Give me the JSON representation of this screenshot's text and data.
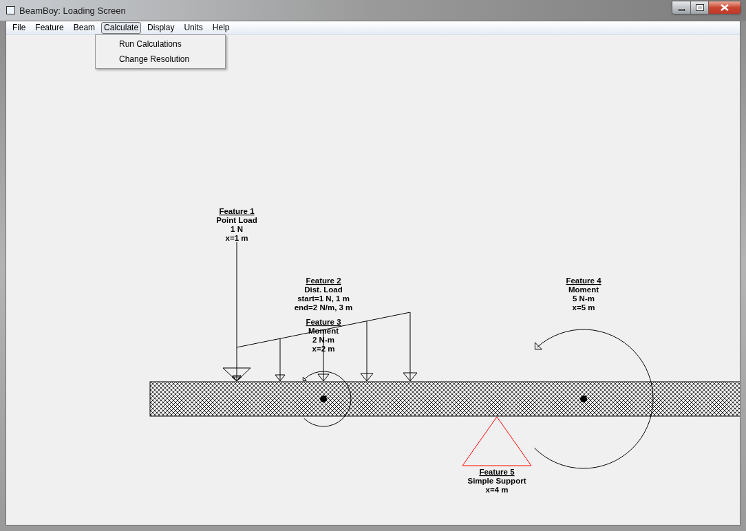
{
  "window": {
    "title": "BeamBoy: Loading Screen"
  },
  "menu": [
    {
      "label": "File",
      "selected": false
    },
    {
      "label": "Feature",
      "selected": false
    },
    {
      "label": "Beam",
      "selected": false
    },
    {
      "label": "Calculate",
      "selected": true
    },
    {
      "label": "Display",
      "selected": false
    },
    {
      "label": "Units",
      "selected": false
    },
    {
      "label": "Help",
      "selected": false
    }
  ],
  "dropdown": {
    "items": [
      "Run Calculations",
      "Change Resolution"
    ]
  },
  "features": [
    {
      "kind": "point_load",
      "title": "Feature 1",
      "lines": [
        "Point Load",
        "1 N",
        "x=1 m"
      ]
    },
    {
      "kind": "dist_load",
      "title": "Feature 2",
      "lines": [
        "Dist. Load",
        "start=1 N, 1 m",
        "end=2 N/m, 3 m"
      ]
    },
    {
      "kind": "moment",
      "title": "Feature 3",
      "lines": [
        "Moment",
        "2 N-m",
        "x=2 m"
      ]
    },
    {
      "kind": "moment",
      "title": "Feature 4",
      "lines": [
        "Moment",
        "5 N-m",
        "x=5 m"
      ]
    },
    {
      "kind": "support",
      "title": "Feature 5",
      "lines": [
        "Simple Support",
        "x=4 m"
      ]
    }
  ]
}
